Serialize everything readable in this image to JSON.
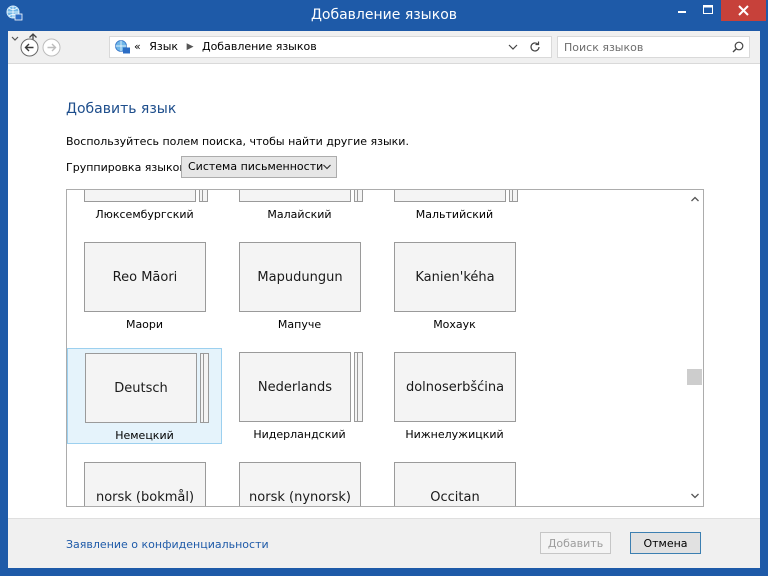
{
  "window": {
    "title": "Добавление языков",
    "accent_color": "#1e5aa8",
    "close_color": "#c7413a"
  },
  "nav": {
    "back_icon": "back-arrow-icon",
    "forward_icon": "forward-arrow-icon",
    "breadcrumb_prefix": "«",
    "breadcrumb": [
      "Язык",
      "Добавление языков"
    ],
    "search_placeholder": "Поиск языков"
  },
  "page": {
    "heading": "Добавить язык",
    "description": "Воспользуйтесь полем поиска, чтобы найти другие языки.",
    "grouping_label": "Группировка языков:",
    "grouping_value": "Система письменности"
  },
  "languages": [
    {
      "native": "",
      "name": "Люксембургский",
      "stacked": true
    },
    {
      "native": "",
      "name": "Малайский",
      "stacked": true
    },
    {
      "native": "",
      "name": "Мальтийский",
      "stacked": true
    },
    {
      "native": "Reo Māori",
      "name": "Маори",
      "stacked": false
    },
    {
      "native": "Mapudungun",
      "name": "Мапуче",
      "stacked": false
    },
    {
      "native": "Kanien'kéha",
      "name": "Мохаук",
      "stacked": false
    },
    {
      "native": "Deutsch",
      "name": "Немецкий",
      "stacked": true,
      "selected": true
    },
    {
      "native": "Nederlands",
      "name": "Нидерландский",
      "stacked": true
    },
    {
      "native": "dolnoserbšćina",
      "name": "Нижнелужицкий",
      "stacked": false
    },
    {
      "native": "norsk (bokmål)",
      "name": "",
      "stacked": false
    },
    {
      "native": "norsk (nynorsk)",
      "name": "",
      "stacked": false
    },
    {
      "native": "Occitan",
      "name": "",
      "stacked": false
    }
  ],
  "footer": {
    "privacy_link": "Заявление о конфиденциальности",
    "add_label": "Добавить",
    "cancel_label": "Отмена",
    "add_disabled": true
  }
}
